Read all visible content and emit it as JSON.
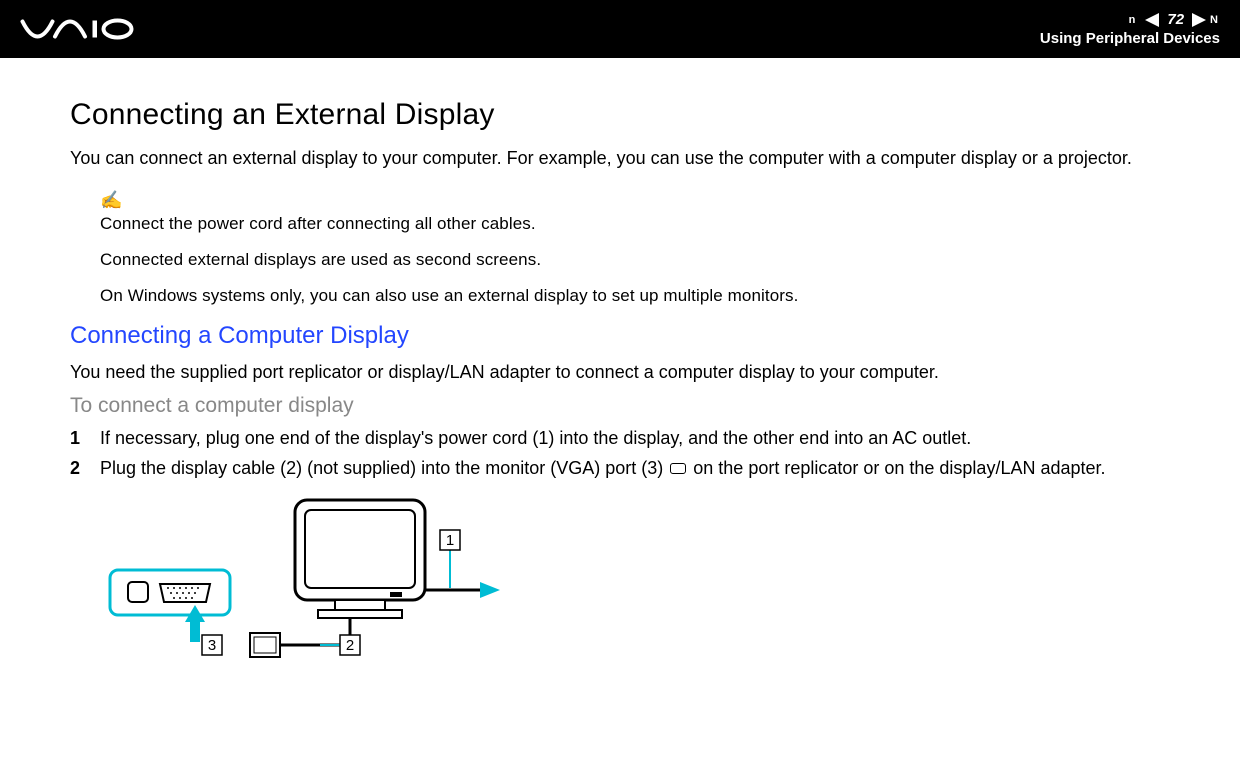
{
  "header": {
    "page_number": "72",
    "n_mark_left": "n",
    "n_mark_right": "N",
    "section": "Using Peripheral Devices"
  },
  "content": {
    "title": "Connecting an External Display",
    "intro": "You can connect an external display to your computer. For example, you can use the computer with a computer display or a projector.",
    "notes": {
      "icon": "✍",
      "line1": "Connect the power cord after connecting all other cables.",
      "line2": "Connected external displays are used as second screens.",
      "line3": "On Windows systems only, you can also use an external display to set up multiple monitors."
    },
    "subtitle": "Connecting a Computer Display",
    "subtitle_text": "You need the supplied port replicator or display/LAN adapter to connect a computer display to your computer.",
    "procedure_title": "To connect a computer display",
    "steps": [
      {
        "num": "1",
        "text": "If necessary, plug one end of the display's power cord (1) into the display, and the other end into an AC outlet."
      },
      {
        "num": "2",
        "text_before": "Plug the display cable (2) (not supplied) into the monitor (VGA) port (3) ",
        "text_after": " on the port replicator or on the display/LAN adapter."
      }
    ],
    "diagram_labels": {
      "l1": "1",
      "l2": "2",
      "l3": "3"
    }
  }
}
